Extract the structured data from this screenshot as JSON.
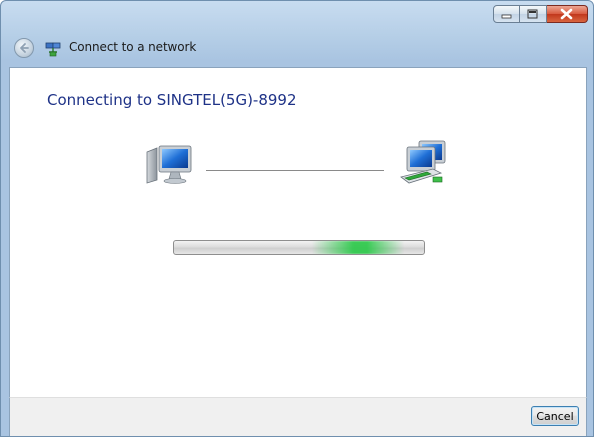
{
  "window": {
    "title": "Connect to a network",
    "controls": [
      "minimize",
      "maximize",
      "close"
    ]
  },
  "main": {
    "heading": "Connecting to SINGTEL(5G)-8992",
    "progress_state": "indeterminate",
    "left_icon": "computer-icon",
    "right_icon": "network-icon"
  },
  "footer": {
    "cancel_label": "Cancel"
  },
  "colors": {
    "heading": "#1e3287",
    "progress_glow": "#28c846",
    "close_button": "#c1371c",
    "frame": "#a9c4e1"
  }
}
